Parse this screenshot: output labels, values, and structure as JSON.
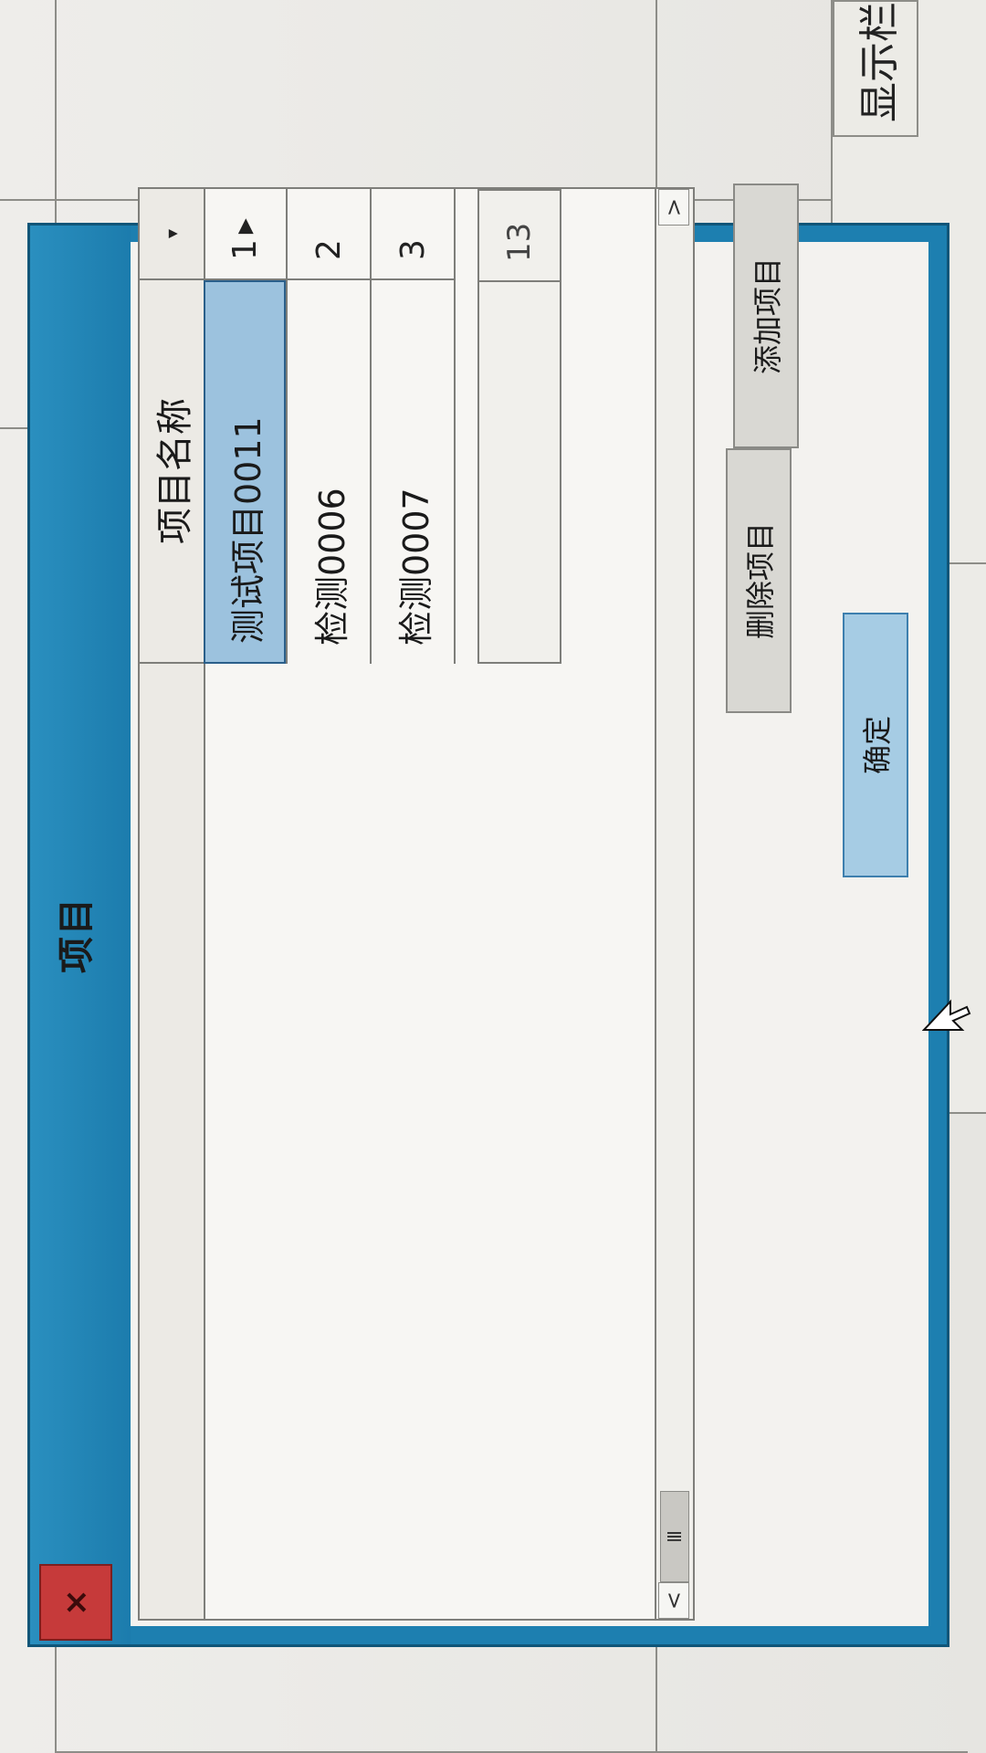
{
  "background": {
    "label_box_text": "显示栏"
  },
  "dialog": {
    "title": "项目",
    "close_label": "×"
  },
  "grid": {
    "corner_indicator": "▾",
    "column_header": "项目名称",
    "rows": [
      {
        "num": "1",
        "indicator": "▶",
        "name": "测试项目0011",
        "selected": true
      },
      {
        "num": "2",
        "indicator": "",
        "name": "检测0006",
        "selected": false
      },
      {
        "num": "3",
        "indicator": "",
        "name": "检测0007",
        "selected": false
      }
    ],
    "count_num": "13",
    "hscroll_thumb": "Ⅲ",
    "hscroll_left": "<",
    "hscroll_right": ">"
  },
  "buttons": {
    "add": "添加项目",
    "delete": "删除项目",
    "ok": "确定"
  }
}
